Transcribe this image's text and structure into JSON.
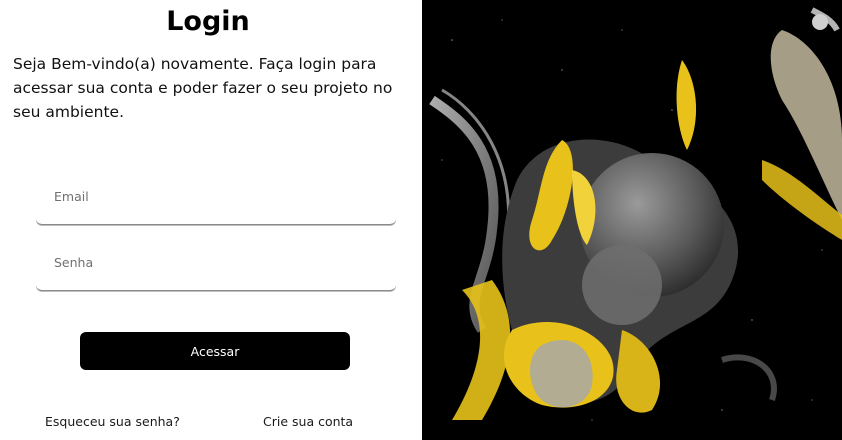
{
  "login": {
    "title": "Login",
    "subtitle": "Seja Bem-vindo(a) novamente. Faça login para acessar sua conta e poder fazer o seu projeto no seu ambiente.",
    "email_placeholder": "Email",
    "password_placeholder": "Senha",
    "submit_label": "Acessar",
    "forgot_password_label": "Esqueceu sua senha?",
    "create_account_label": "Crie sua conta"
  },
  "colors": {
    "button_bg": "#000000",
    "button_text": "#ffffff",
    "art_background": "#000000",
    "art_gold": "#e8c21a",
    "art_silver": "#8c8c8c"
  }
}
